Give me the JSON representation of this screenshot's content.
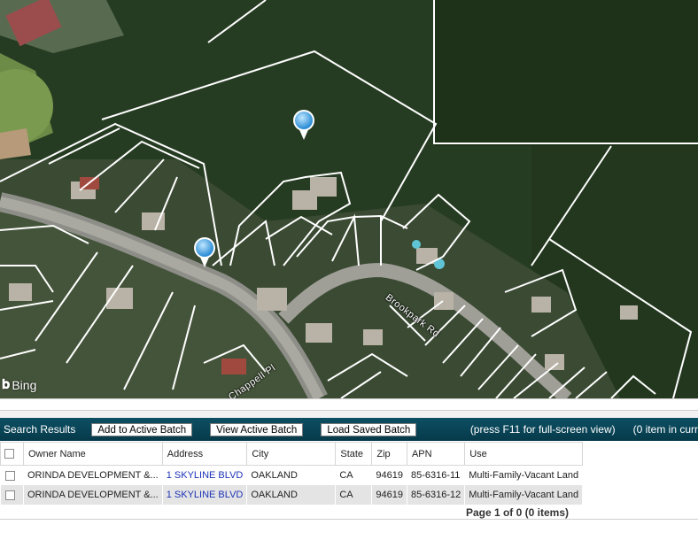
{
  "map": {
    "provider_logo": "Bing",
    "road_labels": [
      "Brookpark Rd",
      "Chappell Pl"
    ],
    "pins": [
      "map-pin",
      "map-pin"
    ]
  },
  "toolbar": {
    "title": "Search Results",
    "add_batch_label": "Add to Active Batch",
    "view_batch_label": "View Active Batch",
    "load_batch_label": "Load Saved Batch",
    "hint": "(press F11 for full-screen view)",
    "item_count": "(0 item in curr"
  },
  "table": {
    "columns": [
      "Owner Name",
      "Address",
      "City",
      "State",
      "Zip",
      "APN",
      "Use"
    ],
    "rows": [
      [
        "ORINDA DEVELOPMENT &...",
        "1 SKYLINE BLVD",
        "OAKLAND",
        "CA",
        "94619",
        "85-6316-11",
        "Multi-Family-Vacant Land"
      ],
      [
        "ORINDA DEVELOPMENT &...",
        "1 SKYLINE BLVD",
        "OAKLAND",
        "CA",
        "94619",
        "85-6316-12",
        "Multi-Family-Vacant Land"
      ]
    ]
  },
  "pager": {
    "text": "Page 1 of 0 (0 items)"
  },
  "colors": {
    "toolbar": "#0d4f63",
    "link": "#1c33b8",
    "row_alt": "#e4e4e4",
    "pin": "#3aa4e3"
  }
}
